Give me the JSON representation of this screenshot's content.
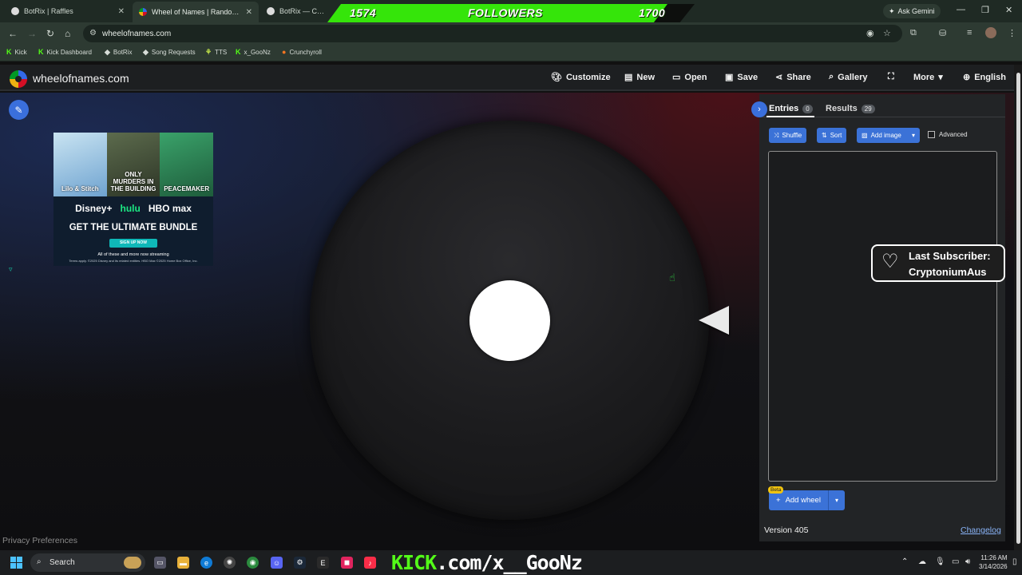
{
  "browser": {
    "tabs": [
      {
        "title": "BotRix | Raffles"
      },
      {
        "title": "Wheel of Names | Random name picker"
      },
      {
        "title": "BotRix — Cloud Stream"
      }
    ],
    "ask_gemini": "Ask Gemini",
    "url": "wheelofnames.com",
    "bookmarks": [
      "Kick",
      "Kick Dashboard",
      "BotRix",
      "Song Requests",
      "TTS",
      "x_GooNz",
      "Crunchyroll"
    ]
  },
  "overlay": {
    "followers_current": "1574",
    "followers_label": "FOLLOWERS",
    "followers_goal": "1700",
    "followers_progress": 0.926,
    "last_subscriber_label": "Last Subscriber:",
    "last_subscriber_name": "CryptoniumAus",
    "kick_prefix": "KICK",
    "kick_suffix": ".com/x__GooNz"
  },
  "site": {
    "name": "wheelofnames.com",
    "menu": [
      "Customize",
      "New",
      "Open",
      "Save",
      "Share",
      "Gallery",
      "More",
      "English"
    ]
  },
  "ad": {
    "poster_titles": [
      "Lilo & Stitch",
      "ONLY MURDERS IN THE BUILDING",
      "PEACEMAKER"
    ],
    "brand_disney": "Disney+",
    "brand_hulu": "hulu",
    "brand_hbo": "HBO max",
    "headline": "GET THE ULTIMATE BUNDLE",
    "cta": "SIGN UP NOW",
    "subline": "All of these and more now streaming",
    "fine_print": "Terms apply. ©2025 Disney and its related entities. HBO Max ©2025 Home Box Office, Inc."
  },
  "panel": {
    "tab_entries": "Entries",
    "tab_entries_count": "0",
    "tab_results": "Results",
    "tab_results_count": "29",
    "shuffle": "Shuffle",
    "sort": "Sort",
    "add_image": "Add image",
    "advanced": "Advanced",
    "entries_text": "",
    "beta": "Beta",
    "add_wheel": "Add wheel",
    "version": "Version 405",
    "changelog": "Changelog"
  },
  "footer": {
    "privacy": "Privacy Preferences"
  },
  "taskbar": {
    "search_placeholder": "Search",
    "time": "11:26 AM",
    "date": "3/14/2026"
  },
  "colors": {
    "accent_blue": "#3b72d7",
    "kick_green": "#53fc18",
    "followers_green": "#35e50a"
  }
}
